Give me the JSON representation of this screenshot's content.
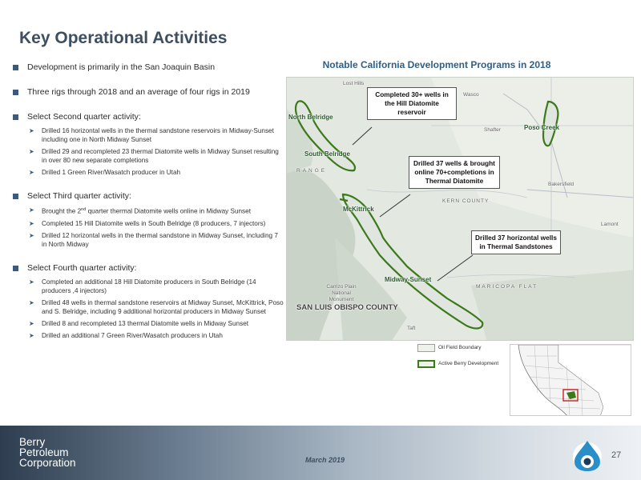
{
  "page": {
    "title": "Key Operational Activities",
    "page_number": "27",
    "date": "March 2019",
    "company_logo": [
      "Berry",
      "Petroleum",
      "Corporation"
    ]
  },
  "bullets": {
    "dev": "Development is primarily in the San Joaquin Basin",
    "rigs": "Three rigs through 2018 and an average of four rigs in 2019",
    "q2": {
      "head": "Select Second quarter activity:",
      "items": [
        "Drilled 16 horizontal wells in the thermal sandstone reservoirs in Midway-Sunset including one in North Midway Sunset",
        "Drilled 29 and recompleted 23 thermal Diatomite wells in Midway Sunset resulting in over 80 new separate completions",
        "Drilled 1 Green River/Wasatch producer in Utah"
      ]
    },
    "q3": {
      "head": "Select Third quarter activity:",
      "item1_pre": "Brought the 2",
      "item1_sup": "nd",
      "item1_post": " quarter thermal Diatomite wells online in Midway Sunset",
      "item2": " Completed 15 Hill Diatomite wells in South Belridge (8 producers, 7 injectors)",
      "item3": "Drilled 12 horizontal wells in the thermal sandstone in Midway Sunset, including 7 in North Midway"
    },
    "q4": {
      "head": "Select Fourth quarter activity:",
      "items": [
        "Completed an additional 18 Hill Diatomite producers in South Belridge (14 producers ,4 injectors)",
        "Drilled 48 wells in thermal sandstone reservoirs at Midway Sunset, McKittrick, Poso and S. Belridge, including 9 additional horizontal producers in Midway Sunset",
        "Drilled 8 and recompleted 13 thermal Diatomite wells in Midway Sunset",
        "Drilled an additional 7 Green River/Wasatch producers in Utah"
      ]
    }
  },
  "map": {
    "title": "Notable California Development Programs in 2018",
    "fields": {
      "north_belridge": "North Belridge",
      "south_belridge": "South Belridge",
      "mckittrick": "McKittrick",
      "midway_sunset": "Midway-Sunset",
      "poso_creek": "Poso Creek"
    },
    "places": {
      "lost_hills": "Lost Hills",
      "wasco": "Wasco",
      "shafter": "Shafter",
      "bakersfield": "Bakersfield",
      "lamont": "Lamont",
      "county": "SAN LUIS OBISPO COUNTY",
      "maricopa_flat": "MARICOPA FLAT",
      "kern_county": "KERN COUNTY",
      "carrizo": "Carrizo Plain National Monument",
      "taft": "Taft",
      "range": "RANGE"
    },
    "callouts": {
      "hill_diatomite": "Completed 30+ wells in the Hill Diatomite reservoir",
      "thermal_diatomite": "Drilled 37 wells & brought online 70+completions in Thermal Diatomite",
      "thermal_sandstones": "Drilled 37 horizontal wells in Thermal Sandstones"
    },
    "legend": {
      "oil_field": "Oil Field Boundary",
      "active_dev": "Active Berry Development"
    },
    "colors": {
      "field_outline": "#3a7a1a",
      "title": "#2f5f86",
      "inset_highlight": "#cc2222"
    }
  }
}
